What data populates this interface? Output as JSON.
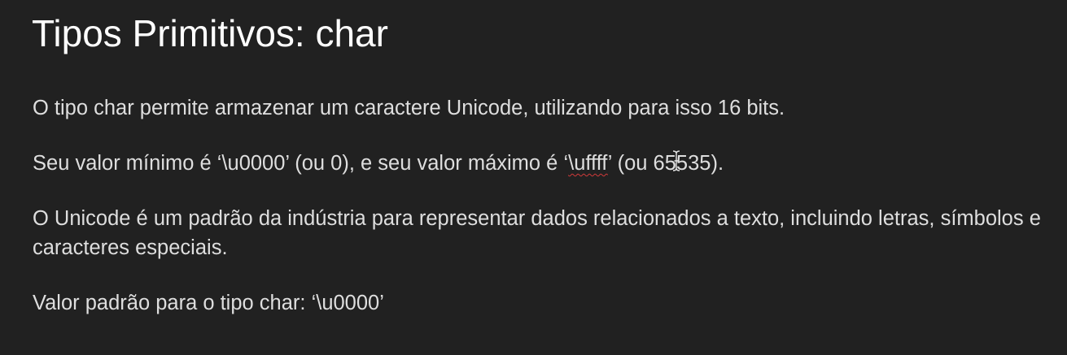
{
  "slide": {
    "title": "Tipos Primitivos: char",
    "paragraphs": [
      {
        "text": "O tipo char permite armazenar um caractere Unicode, utilizando para isso 16 bits."
      },
      {
        "part1": "Seu valor mínimo é ‘\\u0000’ (ou 0), e seu valor máximo é ‘",
        "misspelled": "\\uffff",
        "part2a": "’ (ou 65",
        "part2b": "535)."
      },
      {
        "text": "O Unicode é um padrão da indústria para representar dados relacionados a texto, incluindo letras, símbolos e caracteres especiais."
      },
      {
        "text": "Valor padrão para o tipo char: ‘\\u0000’"
      }
    ]
  },
  "colors": {
    "background": "#212121",
    "title": "#ffffff",
    "text": "#dedede",
    "spellcheck_underline": "#d23a3a"
  },
  "icons": {
    "cursor": "text-cursor-icon"
  }
}
